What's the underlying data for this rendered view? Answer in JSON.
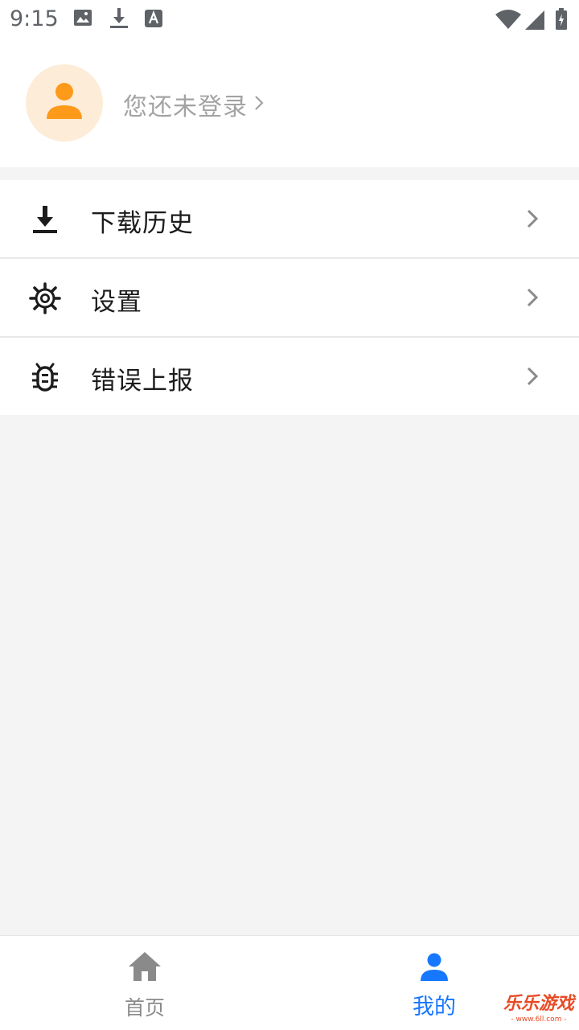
{
  "status_bar": {
    "time": "9:15",
    "icons": [
      "image-icon",
      "download-icon",
      "a-text-icon",
      "wifi-icon",
      "signal-icon",
      "battery-icon"
    ]
  },
  "profile": {
    "login_prompt": "您还未登录",
    "avatar_color": "#fd9a1a",
    "avatar_bg": "#fdecd8"
  },
  "menu": {
    "items": [
      {
        "label": "下载历史",
        "icon": "download-icon"
      },
      {
        "label": "设置",
        "icon": "gear-icon"
      },
      {
        "label": "错误上报",
        "icon": "bug-icon"
      }
    ]
  },
  "tabbar": {
    "tabs": [
      {
        "label": "首页",
        "icon": "home-icon",
        "active": false
      },
      {
        "label": "我的",
        "icon": "user-icon",
        "active": true
      }
    ],
    "active_color": "#1677ff",
    "inactive_color": "#8a8a8a"
  },
  "watermark": {
    "main": "乐乐游戏",
    "sub": "- www.6ll.com -"
  }
}
